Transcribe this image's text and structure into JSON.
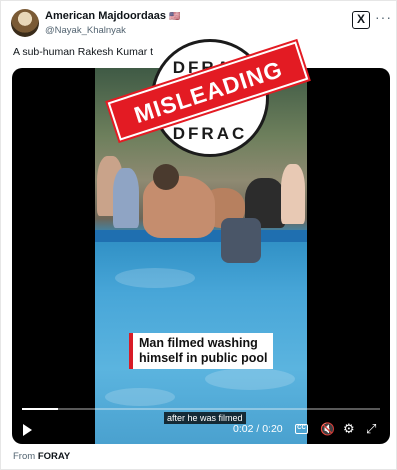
{
  "author": {
    "display_name": "American Majdoordaas",
    "flag": "🇺🇸",
    "handle": "@Nayak_Khalnyak"
  },
  "header_icons": {
    "x_logo": "x-logo-icon",
    "more": "more-icon",
    "x_logo_glyph": "X",
    "more_glyph": "···"
  },
  "tweet_text": "A sub-human Rakesh Kumar t",
  "video": {
    "caption_lines": [
      "Man filmed washing",
      "himself in public pool"
    ],
    "subtitle": "after he was filmed",
    "time": "0:02 / 0:20",
    "progress": 0.1,
    "cc_label": "CC"
  },
  "stamp": {
    "top_text": "DFRAC",
    "bottom_text": "DFRAC",
    "banner": "MISLEADING",
    "banner_color": "#e31b23"
  },
  "source": {
    "label": "From",
    "name": "FORAY"
  }
}
